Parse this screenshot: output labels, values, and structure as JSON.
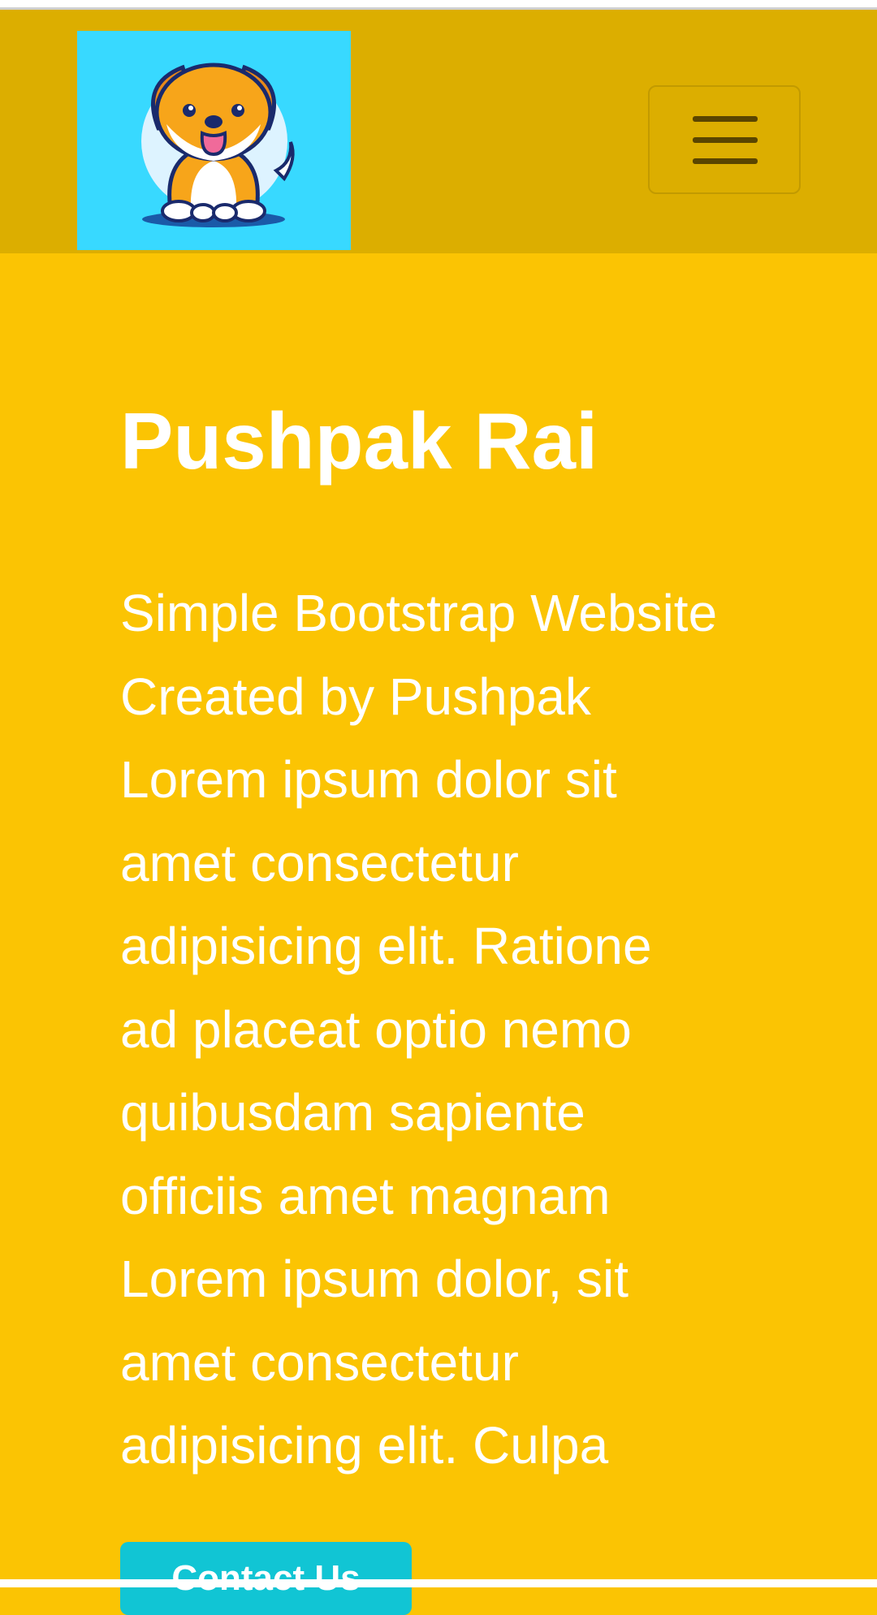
{
  "hero": {
    "title": "Pushpak Rai",
    "lines": [
      "Simple Bootstrap Website",
      "Created by Pushpak",
      "Lorem ipsum dolor sit",
      "amet consectetur",
      "adipisicing elit. Ratione",
      "ad placeat optio nemo",
      "quibusdam sapiente",
      "officiis amet magnam",
      "Lorem ipsum dolor, sit",
      "amet consectetur",
      "adipisicing elit. Culpa"
    ],
    "button_label": "Contact Us"
  },
  "navbar": {
    "logo_icon": "dog-logo-icon",
    "toggler_icon": "hamburger-menu-icon"
  },
  "colors": {
    "page_background": "#fbc403",
    "navbar_background": "#dcae00",
    "logo_background": "#38d9ff",
    "button_background": "#11c5d4",
    "text": "#ffffff"
  }
}
